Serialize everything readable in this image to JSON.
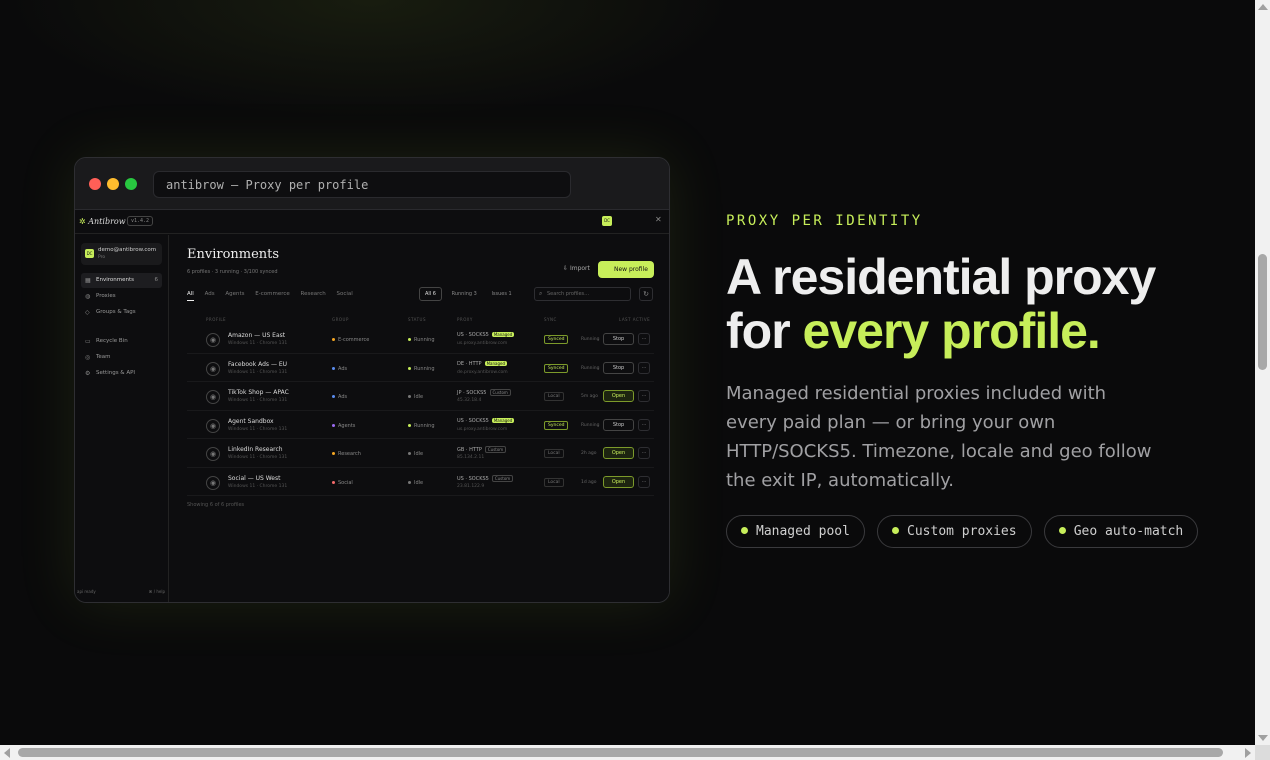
{
  "colors": {
    "accent": "#c7ee5a",
    "background": "#0a0a0b"
  },
  "window": {
    "url_text": "antibrow — Proxy per profile"
  },
  "app": {
    "brand": "Antibrow",
    "version": "v1.4.2",
    "avatar_initials": "DC",
    "account": {
      "email": "demo@antibrow.com",
      "plan": "Pro",
      "initials": "DC"
    },
    "nav": [
      {
        "label": "Environments",
        "count": "6",
        "icon": "grid-icon"
      },
      {
        "label": "Proxies",
        "icon": "globe-icon"
      },
      {
        "label": "Groups & Tags",
        "icon": "tag-icon"
      },
      {
        "label": "Recycle Bin",
        "icon": "trash-icon"
      },
      {
        "label": "Team",
        "icon": "users-icon"
      },
      {
        "label": "Settings & API",
        "icon": "gear-icon"
      }
    ],
    "sidebar_footer": {
      "left": "api ready",
      "right": "⌘ / help"
    },
    "page": {
      "title": "Environments",
      "subtitle": "6 profiles · 3 running · 3/100 synced",
      "import_label": "Import",
      "new_label": "New profile",
      "tabs": [
        "All",
        "Ads",
        "Agents",
        "E-commerce",
        "Research",
        "Social"
      ],
      "status_filters": [
        "All 6",
        "Running 3",
        "Issues 1"
      ],
      "search_placeholder": "Search profiles…",
      "columns": [
        "PROFILE",
        "GROUP",
        "STATUS",
        "PROXY",
        "SYNC",
        "LAST ACTIVE"
      ],
      "rows": [
        {
          "name": "Amazon — US East",
          "os": "Windows 11 · Chrome 131",
          "group": "E-commerce",
          "group_color": "#f5a623",
          "status": "Running",
          "status_color": "#c7ee5a",
          "proxy": "US · SOCKS5",
          "proxy_tag": "Managed",
          "host": "us.proxy.antibrow.com",
          "sync": "Synced",
          "ago": "Running",
          "action": "Stop"
        },
        {
          "name": "Facebook Ads — EU",
          "os": "Windows 11 · Chrome 131",
          "group": "Ads",
          "group_color": "#5b8def",
          "status": "Running",
          "status_color": "#c7ee5a",
          "proxy": "DE · HTTP",
          "proxy_tag": "Managed",
          "host": "de.proxy.antibrow.com",
          "sync": "Synced",
          "ago": "Running",
          "action": "Stop"
        },
        {
          "name": "TikTok Shop — APAC",
          "os": "Windows 11 · Chrome 131",
          "group": "Ads",
          "group_color": "#5b8def",
          "status": "Idle",
          "status_color": "#777777",
          "proxy": "JP · SOCKS5",
          "proxy_tag": "Custom",
          "host": "45.32.18.4",
          "sync": "Local",
          "ago": "5m ago",
          "action": "Open"
        },
        {
          "name": "Agent Sandbox",
          "os": "Windows 11 · Chrome 131",
          "group": "Agents",
          "group_color": "#9b6bf2",
          "status": "Running",
          "status_color": "#c7ee5a",
          "proxy": "US · SOCKS5",
          "proxy_tag": "Managed",
          "host": "us.proxy.antibrow.com",
          "sync": "Synced",
          "ago": "Running",
          "action": "Stop"
        },
        {
          "name": "LinkedIn Research",
          "os": "Windows 11 · Chrome 131",
          "group": "Research",
          "group_color": "#f5a623",
          "status": "Idle",
          "status_color": "#777777",
          "proxy": "GB · HTTP",
          "proxy_tag": "Custom",
          "host": "85.134.2.11",
          "sync": "Local",
          "ago": "2h ago",
          "action": "Open"
        },
        {
          "name": "Social — US West",
          "os": "Windows 11 · Chrome 131",
          "group": "Social",
          "group_color": "#f56b6b",
          "status": "Idle",
          "status_color": "#777777",
          "proxy": "US · SOCKS5",
          "proxy_tag": "Custom",
          "host": "23.81.122.9",
          "sync": "Local",
          "ago": "1d ago",
          "action": "Open"
        }
      ],
      "showing": "Showing 6 of 6 profiles"
    }
  },
  "hero": {
    "eyebrow": "PROXY PER IDENTITY",
    "headline_line1": "A residential proxy",
    "headline_for": "for ",
    "headline_accent": "every profile.",
    "description": "Managed residential proxies included with every paid plan — or bring your own HTTP/SOCKS5. Timezone, locale and geo follow the exit IP, automatically.",
    "pills": [
      "Managed pool",
      "Custom proxies",
      "Geo auto-match"
    ]
  }
}
